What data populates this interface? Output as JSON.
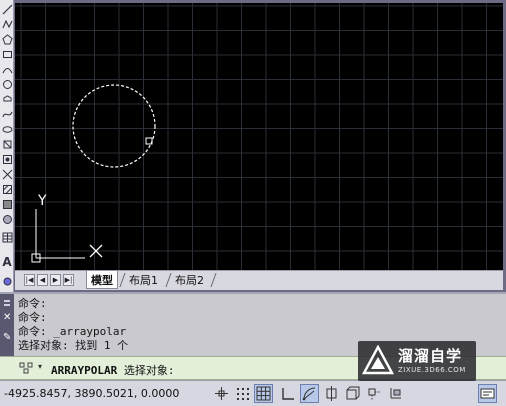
{
  "left_toolbar": {
    "tools": [
      "line-tool-icon",
      "polyline-tool-icon",
      "polygon-tool-icon",
      "rectangle-tool-icon",
      "arc-tool-icon",
      "circle-tool-icon",
      "revcloud-tool-icon",
      "spline-tool-icon",
      "ellipse-tool-icon",
      "insert-block-icon",
      "make-block-icon",
      "point-icon",
      "hatch-icon",
      "gradient-icon",
      "region-icon",
      "table-icon",
      "text-icon",
      "add-selected-icon"
    ]
  },
  "drawing": {
    "background": "#000000",
    "grid_color": "#2a2e36",
    "ucs_labels": {
      "y": "Y"
    }
  },
  "tabs": {
    "items": [
      {
        "label": "模型",
        "active": true
      },
      {
        "label": "布局1",
        "active": false
      },
      {
        "label": "布局2",
        "active": false
      }
    ]
  },
  "command_window": {
    "lines": [
      "命令:",
      "命令:",
      "命令: _arraypolar",
      "选择对象: 找到 1 个"
    ]
  },
  "prompt": {
    "command": "ARRAYPOLAR",
    "text": "选择对象:"
  },
  "status_bar": {
    "coordinates": "-4925.8457, 3890.5021, 0.0000",
    "buttons": [
      {
        "name": "infer-constraints-icon",
        "active": false
      },
      {
        "name": "snap-mode-icon",
        "active": false
      },
      {
        "name": "grid-display-icon",
        "active": true
      },
      {
        "name": "ortho-mode-icon",
        "active": false
      },
      {
        "name": "polar-tracking-icon",
        "active": true
      },
      {
        "name": "object-snap-icon",
        "active": false
      },
      {
        "name": "3d-object-snap-icon",
        "active": false
      },
      {
        "name": "object-snap-tracking-icon",
        "active": false
      },
      {
        "name": "dynamic-ucs-icon",
        "active": false
      },
      {
        "name": "dynamic-input-icon",
        "active": true
      }
    ]
  },
  "watermark": {
    "title": "溜溜自学",
    "subtitle": "ZIXUE.3D66.COM"
  }
}
